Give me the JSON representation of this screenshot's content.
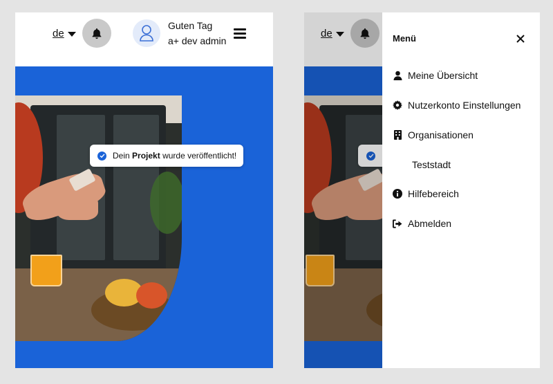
{
  "header": {
    "language": "de",
    "greeting_line1": "Guten Tag",
    "greeting_line2": "a+ dev admin"
  },
  "toast": {
    "prefix": "Dein",
    "bold": "Projekt",
    "suffix": "wurde veröffentlicht!"
  },
  "menu": {
    "title": "Menü",
    "items": [
      {
        "label": "Meine Übersicht",
        "icon": "user-icon"
      },
      {
        "label": "Nutzerkonto Einstellungen",
        "icon": "gear-icon"
      },
      {
        "label": "Organisationen",
        "icon": "building-icon"
      },
      {
        "label": "Teststadt",
        "icon": ""
      },
      {
        "label": "Hilfebereich",
        "icon": "info-icon"
      },
      {
        "label": "Abmelden",
        "icon": "logout-icon"
      }
    ]
  },
  "colors": {
    "brand_blue": "#1a63d8",
    "bell_bg": "#c9c9c9",
    "avatar_bg": "#e3ebfa"
  }
}
